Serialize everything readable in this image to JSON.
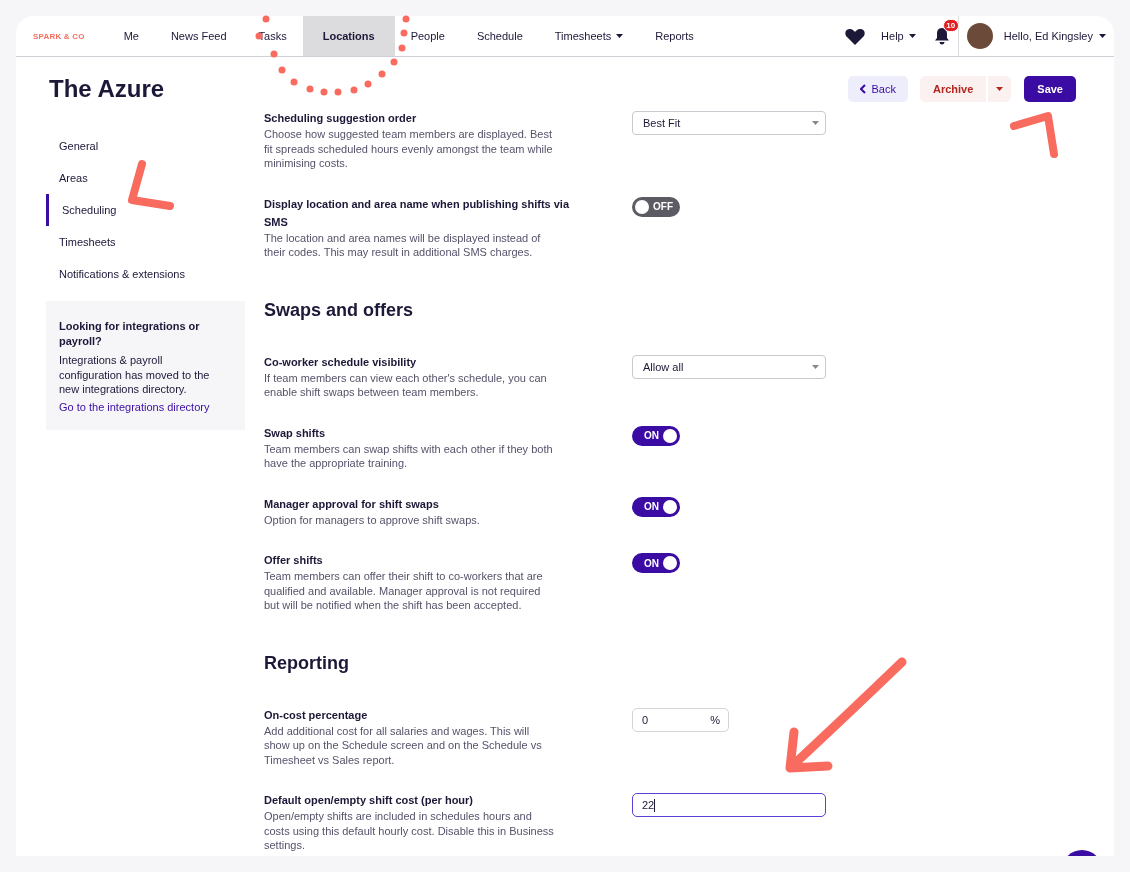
{
  "brand": "SPARK & CO",
  "nav": [
    {
      "label": "Me",
      "selected": false,
      "dropdown": false
    },
    {
      "label": "News Feed",
      "selected": false,
      "dropdown": false
    },
    {
      "label": "Tasks",
      "selected": false,
      "dropdown": false
    },
    {
      "label": "Locations",
      "selected": true,
      "dropdown": false
    },
    {
      "label": "People",
      "selected": false,
      "dropdown": false
    },
    {
      "label": "Schedule",
      "selected": false,
      "dropdown": false
    },
    {
      "label": "Timesheets",
      "selected": false,
      "dropdown": true
    },
    {
      "label": "Reports",
      "selected": false,
      "dropdown": false
    }
  ],
  "nav_right": {
    "help": "Help",
    "notification_count": "10",
    "greeting": "Hello, Ed Kingsley"
  },
  "page_title": "The Azure",
  "actions": {
    "back": "Back",
    "archive": "Archive",
    "save": "Save"
  },
  "sidebar": {
    "items": [
      {
        "label": "General",
        "selected": false
      },
      {
        "label": "Areas",
        "selected": false
      },
      {
        "label": "Scheduling",
        "selected": true
      },
      {
        "label": "Timesheets",
        "selected": false
      },
      {
        "label": "Notifications & extensions",
        "selected": false
      }
    ],
    "callout": {
      "title": "Looking for integrations or payroll?",
      "text": "Integrations & payroll configuration has moved to the new integrations directory.",
      "link": "Go to the integrations directory"
    }
  },
  "sections": [
    {
      "settings": [
        {
          "kind": "select",
          "title": "Scheduling suggestion order",
          "description": "Choose how suggested team members are displayed. Best fit spreads scheduled hours evenly amongst the team while minimising costs.",
          "value": "Best Fit"
        },
        {
          "kind": "toggle",
          "title": "Display location and area name when publishing shifts via SMS",
          "description": "The location and area names will be displayed instead of their codes. This may result in additional SMS charges.",
          "on": false,
          "state_label": "OFF"
        }
      ]
    },
    {
      "heading": "Swaps and offers",
      "settings": [
        {
          "kind": "select",
          "title": "Co-worker schedule visibility",
          "description": "If team members can view each other's schedule, you can enable shift swaps between team members.",
          "value": "Allow all"
        },
        {
          "kind": "toggle",
          "title": "Swap shifts",
          "description": "Team members can swap shifts with each other if they both have the appropriate training.",
          "on": true,
          "state_label": "ON"
        },
        {
          "kind": "toggle",
          "title": "Manager approval for shift swaps",
          "description": "Option for managers to approve shift swaps.",
          "on": true,
          "state_label": "ON"
        },
        {
          "kind": "toggle",
          "title": "Offer shifts",
          "description": "Team members can offer their shift to co-workers that are qualified and available. Manager approval is not required but will be notified when the shift has been accepted.",
          "on": true,
          "state_label": "ON"
        }
      ]
    },
    {
      "heading": "Reporting",
      "settings": [
        {
          "kind": "percent",
          "title": "On-cost percentage",
          "description": "Add additional cost for all salaries and wages. This will show up on the Schedule screen and on the Schedule vs Timesheet vs Sales report.",
          "value": "0",
          "unit": "%"
        },
        {
          "kind": "text",
          "title": "Default open/empty shift cost (per hour)",
          "description": "Open/empty shifts are included in schedules hours and costs using this default hourly cost. Disable this in Business settings.",
          "value": "22",
          "focused": true
        }
      ]
    }
  ]
}
